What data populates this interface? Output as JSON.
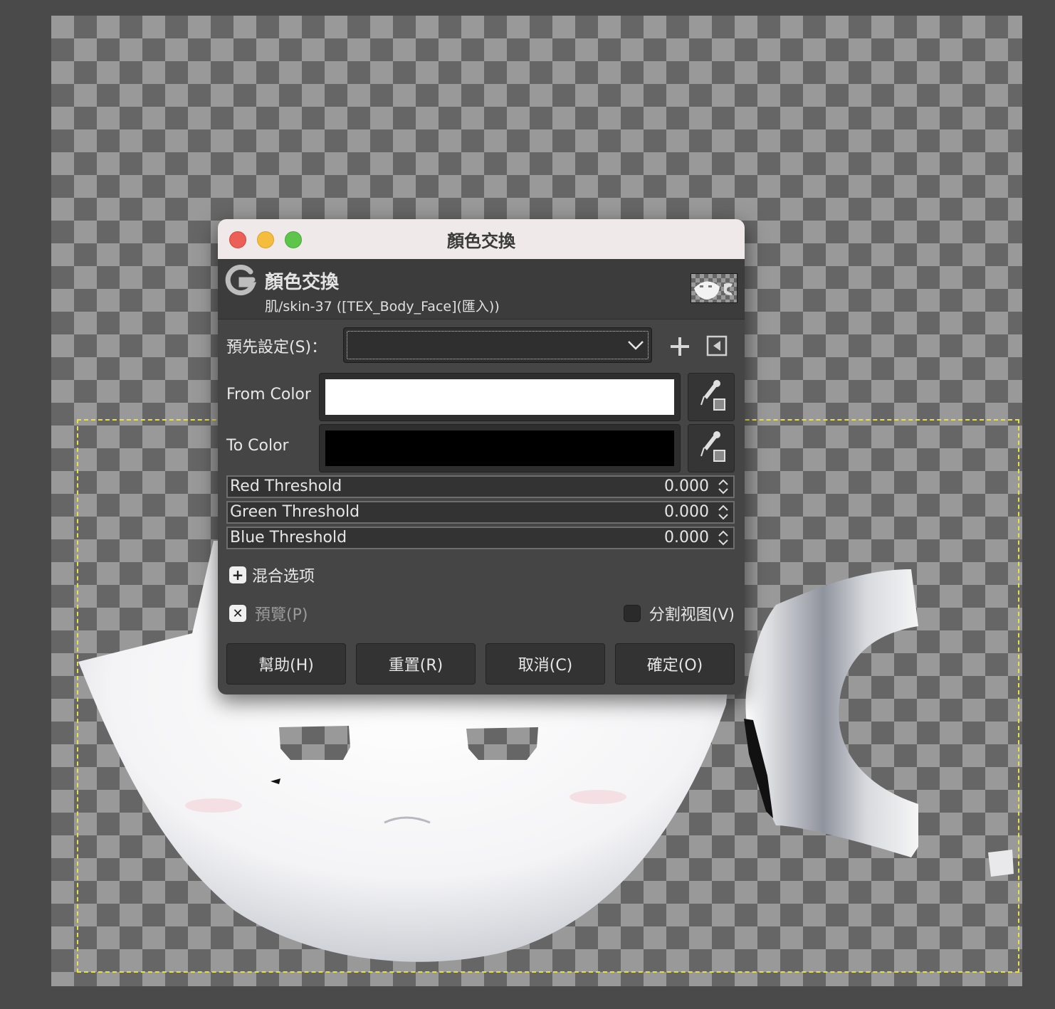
{
  "window": {
    "title": "顏色交換"
  },
  "header": {
    "title": "顏色交換",
    "subtitle": "肌/skin-37 ([TEX_Body_Face](匯入))"
  },
  "presets": {
    "label": "預先設定(S)：",
    "value": ""
  },
  "from_color": {
    "label": "From Color",
    "color": "#ffffff"
  },
  "to_color": {
    "label": "To Color",
    "color": "#000000"
  },
  "thresholds": [
    {
      "label": "Red Threshold",
      "value": "0.000"
    },
    {
      "label": "Green Threshold",
      "value": "0.000"
    },
    {
      "label": "Blue Threshold",
      "value": "0.000"
    }
  ],
  "blending": {
    "expander_icon": "+",
    "label": "混合选项"
  },
  "preview": {
    "label": "預覽(P)",
    "checked": true,
    "check_glyph": "✕"
  },
  "split_view": {
    "label": "分割视图(V)",
    "checked": false
  },
  "buttons": {
    "help": "幫助(H)",
    "reset": "重置(R)",
    "cancel": "取消(C)",
    "ok": "確定(O)"
  },
  "icons": {
    "app_logo": "gimp-logo-icon",
    "preset_dropdown": "chevron-down-icon",
    "preset_add": "plus-icon",
    "preset_menu": "preset-menu-icon",
    "color_picker": "eyedropper-icon"
  },
  "colors": {
    "dialog_bg": "#454545",
    "titlebar_bg": "#efe9e9",
    "selection_outline": "#e8e04a"
  }
}
